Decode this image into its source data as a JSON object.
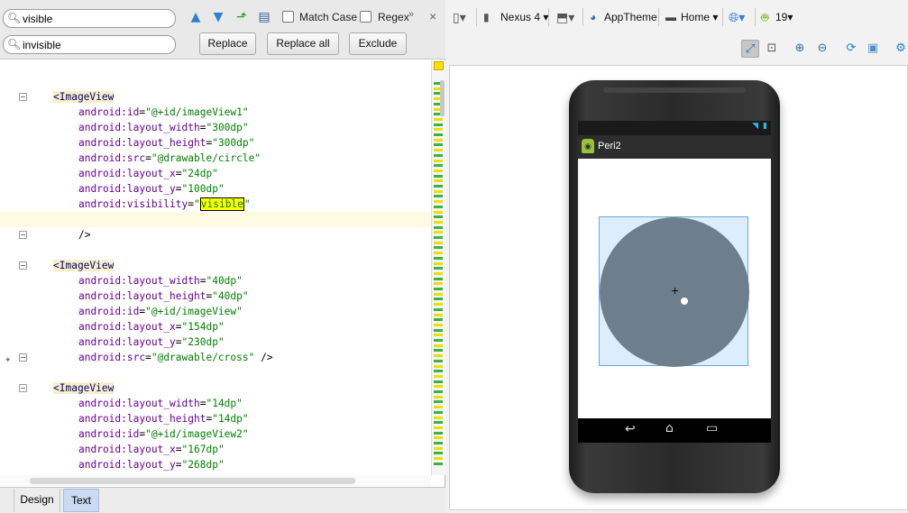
{
  "find": {
    "search_value": "visible",
    "replace_value": "invisible",
    "match_case_label": "Match Case",
    "regex_label": "Regex",
    "more_glyph": "»",
    "close_glyph": "×",
    "replace_label": "Replace",
    "replace_all_label": "Replace all",
    "exclude_label": "Exclude"
  },
  "code_lines": [
    {
      "indent": 0,
      "tag": "<ImageView",
      "fold": true
    },
    {
      "indent": 1,
      "attr": "android:id",
      "val": "\"@+id/imageView1\""
    },
    {
      "indent": 1,
      "attr": "android:layout_width",
      "val": "\"300dp\""
    },
    {
      "indent": 1,
      "attr": "android:layout_height",
      "val": "\"300dp\""
    },
    {
      "indent": 1,
      "attr": "android:src",
      "val": "\"@drawable/circle\""
    },
    {
      "indent": 1,
      "attr": "android:layout_x",
      "val": "\"24dp\""
    },
    {
      "indent": 1,
      "attr": "android:layout_y",
      "val": "\"100dp\""
    },
    {
      "indent": 1,
      "attr": "android:visibility",
      "val_pre": "\"",
      "match": "visible",
      "val_post": "\""
    },
    {
      "indent": 0,
      "blank": true,
      "highlight": true
    },
    {
      "indent": 1,
      "close": "/>",
      "fold": true
    },
    {
      "indent": 0,
      "blank": true
    },
    {
      "indent": 0,
      "tag": "<ImageView",
      "fold": true
    },
    {
      "indent": 1,
      "attr": "android:layout_width",
      "val": "\"40dp\""
    },
    {
      "indent": 1,
      "attr": "android:layout_height",
      "val": "\"40dp\""
    },
    {
      "indent": 1,
      "attr": "android:id",
      "val": "\"@+id/imageView\""
    },
    {
      "indent": 1,
      "attr": "android:layout_x",
      "val": "\"154dp\""
    },
    {
      "indent": 1,
      "attr": "android:layout_y",
      "val": "\"230dp\""
    },
    {
      "indent": 1,
      "attr": "android:src",
      "val": "\"@drawable/cross\"",
      "tail": " />",
      "fold": true
    },
    {
      "indent": 0,
      "blank": true
    },
    {
      "indent": 0,
      "tag": "<ImageView",
      "fold": true
    },
    {
      "indent": 1,
      "attr": "android:layout_width",
      "val": "\"14dp\""
    },
    {
      "indent": 1,
      "attr": "android:layout_height",
      "val": "\"14dp\""
    },
    {
      "indent": 1,
      "attr": "android:id",
      "val": "\"@+id/imageView2\""
    },
    {
      "indent": 1,
      "attr": "android:layout_x",
      "val": "\"167dp\""
    },
    {
      "indent": 1,
      "attr": "android:layout_y",
      "val": "\"268dp\""
    }
  ],
  "tabs": {
    "design": "Design",
    "text": "Text"
  },
  "designer": {
    "device": "Nexus 4",
    "theme": "AppTheme",
    "activity": "Home",
    "api": "19",
    "app_title": "Peri2"
  },
  "colors": {
    "match_highlight": "#ffff00",
    "circle": "#6d7e8c",
    "selection": "#dcedfb"
  }
}
